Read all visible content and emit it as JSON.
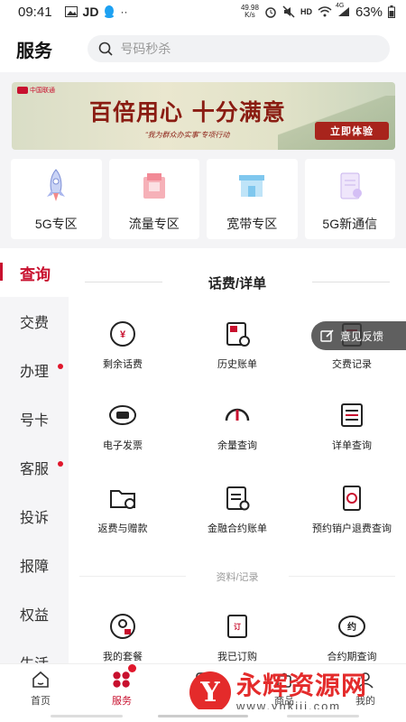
{
  "status_bar": {
    "time": "09:41",
    "carrier_label": "JD",
    "net_speed_value": "49.98",
    "net_speed_unit": "K/s",
    "hd_label": "HD",
    "network_label": "4G",
    "battery_text": "63%"
  },
  "header": {
    "title": "服务",
    "search_placeholder": "号码秒杀"
  },
  "banner": {
    "logo_text": "中国联通",
    "headline": "百倍用心  十分满意",
    "tagline": "“我为群众办实事”专项行动",
    "cta_label": "立即体验"
  },
  "zones": [
    {
      "label": "5G专区",
      "icon": "rocket-icon"
    },
    {
      "label": "流量专区",
      "icon": "data-package-icon"
    },
    {
      "label": "宽带专区",
      "icon": "broadband-store-icon"
    },
    {
      "label": "5G新通信",
      "icon": "5g-messaging-icon"
    }
  ],
  "sidebar": {
    "items": [
      {
        "label": "查询",
        "active": true,
        "dot": false
      },
      {
        "label": "交费",
        "active": false,
        "dot": false
      },
      {
        "label": "办理",
        "active": false,
        "dot": true
      },
      {
        "label": "号卡",
        "active": false,
        "dot": false
      },
      {
        "label": "客服",
        "active": false,
        "dot": true
      },
      {
        "label": "投诉",
        "active": false,
        "dot": false
      },
      {
        "label": "报障",
        "active": false,
        "dot": false
      },
      {
        "label": "权益",
        "active": false,
        "dot": false
      },
      {
        "label": "生活",
        "active": false,
        "dot": false
      }
    ]
  },
  "main": {
    "section_title": "话费/详单",
    "items": [
      {
        "label": "剩余话费",
        "icon": "yuan-balance-icon"
      },
      {
        "label": "历史账单",
        "icon": "history-bill-icon"
      },
      {
        "label": "交费记录",
        "icon": "payment-record-icon"
      },
      {
        "label": "电子发票",
        "icon": "e-invoice-icon"
      },
      {
        "label": "余量查询",
        "icon": "gauge-icon"
      },
      {
        "label": "详单查询",
        "icon": "detail-list-icon"
      },
      {
        "label": "返费与赠款",
        "icon": "refund-folder-icon"
      },
      {
        "label": "金融合约账单",
        "icon": "finance-contract-icon"
      },
      {
        "label": "预约销户退费查询",
        "icon": "cancel-account-refund-icon"
      }
    ],
    "subsection_title": "资料/记录",
    "sub_items": [
      {
        "label": "我的套餐",
        "icon": "my-plan-icon"
      },
      {
        "label": "我已订购",
        "icon": "subscribed-icon"
      },
      {
        "label": "合约期查询",
        "icon": "contract-period-icon"
      }
    ]
  },
  "feedback": {
    "label": "意见反馈"
  },
  "tabbar": {
    "tabs": [
      {
        "label": "首页",
        "icon": "home-icon",
        "active": false
      },
      {
        "label": "服务",
        "icon": "service-icon",
        "active": true
      },
      {
        "label": "看新",
        "icon": "discover-icon",
        "active": false
      },
      {
        "label": "商品",
        "icon": "shop-icon",
        "active": false
      },
      {
        "label": "我的",
        "icon": "user-icon",
        "active": false
      }
    ]
  },
  "watermark": {
    "title": "永辉资源网",
    "url": "www.yhkjjj.com"
  },
  "colors": {
    "accent": "#c8102e",
    "sidebar_bg": "#f5f5f7"
  }
}
